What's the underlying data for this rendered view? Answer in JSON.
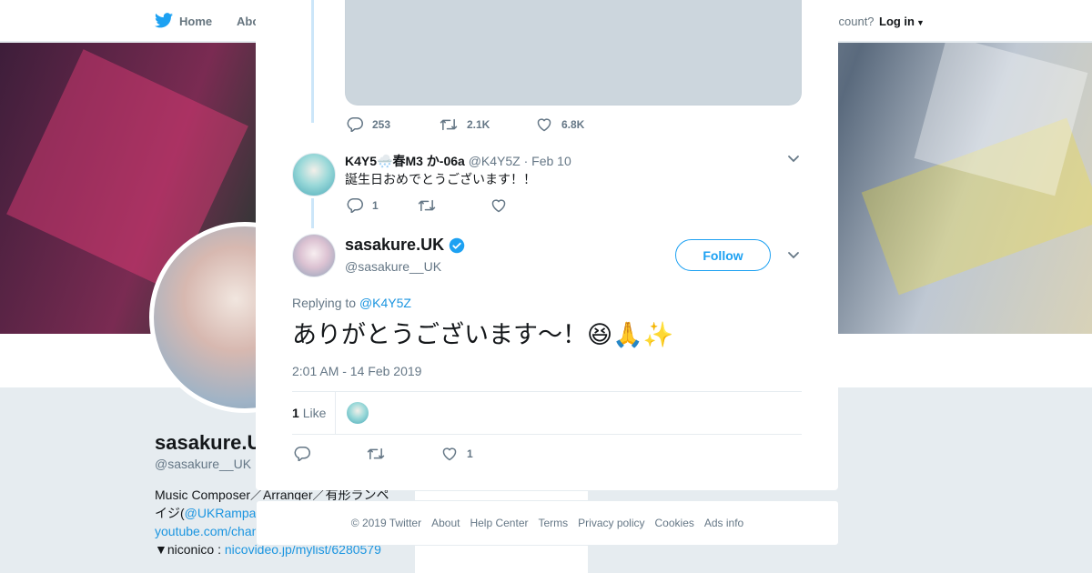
{
  "background": {
    "nav": {
      "home": "Home",
      "about": "Abo",
      "account_prompt": "ccount?",
      "login": "Log in"
    },
    "profile": {
      "name": "sasakure.U",
      "handle": "@sasakure__UK",
      "bio_line1": "Music Composer／Arranger／有形ランペ",
      "bio_line2_prefix": "イジ(",
      "bio_line2_link": "@UKRampa",
      "bio_line3_link": "youtube.com/chan",
      "bio_line4_prefix": "▼niconico : ",
      "bio_line4_link": "nicovideo.jp/mylist/6280579",
      "side_text": "Ads info"
    }
  },
  "modal": {
    "prev_tweet": {
      "replies": "253",
      "retweets": "2.1K",
      "likes": "6.8K"
    },
    "reply": {
      "name": "K4Y5🌨️春M3 か-06a",
      "handle": "@K4Y5Z",
      "date": "· Feb 10",
      "text": "誕生日おめでとうございます！！",
      "replies": "1"
    },
    "main": {
      "name": "sasakure.UK",
      "handle": "@sasakure__UK",
      "follow_label": "Follow",
      "replying_label": "Replying to",
      "replying_to": "@K4Y5Z",
      "text": "ありがとうございます〜！😆🙏✨",
      "timestamp": "2:01 AM - 14 Feb 2019",
      "like_count": "1",
      "like_label": "Like",
      "action_likes": "1"
    }
  },
  "footer": {
    "links": [
      "© 2019 Twitter",
      "About",
      "Help Center",
      "Terms",
      "Privacy policy",
      "Cookies",
      "Ads info"
    ]
  },
  "colors": {
    "accent": "#1da1f2",
    "link": "#1b95e0",
    "muted": "#657786",
    "thread": "#cce6f9"
  }
}
